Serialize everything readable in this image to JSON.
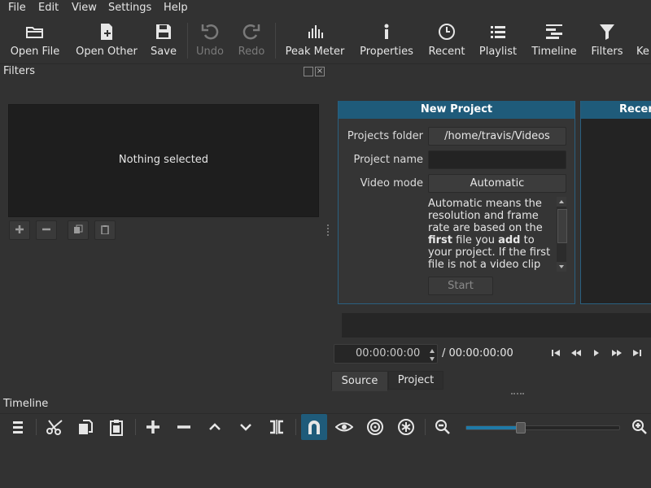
{
  "menu": [
    "File",
    "Edit",
    "View",
    "Settings",
    "Help"
  ],
  "toolbar": {
    "open_file": "Open File",
    "open_other": "Open Other",
    "save": "Save",
    "undo": "Undo",
    "redo": "Redo",
    "peak_meter": "Peak Meter",
    "properties": "Properties",
    "recent": "Recent",
    "playlist": "Playlist",
    "timeline": "Timeline",
    "filters": "Filters",
    "keyframes": "Ke"
  },
  "filters": {
    "title": "Filters",
    "empty_text": "Nothing selected"
  },
  "new_project": {
    "title": "New Project",
    "folder_label": "Projects folder",
    "folder_value": "/home/travis/Videos",
    "name_label": "Project name",
    "name_value": "",
    "mode_label": "Video mode",
    "mode_value": "Automatic",
    "desc_1": "Automatic means the resolution and frame rate are based on the ",
    "desc_2": "first",
    "desc_3": " file you ",
    "desc_4": "add",
    "desc_5": " to your project. If the first file is not a video clip",
    "start": "Start"
  },
  "recent": {
    "title": "Recen"
  },
  "player": {
    "position": "00:00:00:00",
    "duration": "/ 00:00:00:00"
  },
  "tabs": {
    "source": "Source",
    "project": "Project"
  },
  "timeline": {
    "title": "Timeline",
    "zoom_level": 0.35
  },
  "colors": {
    "accent": "#1f5b7a",
    "active_toggle": "#1f5b7a"
  }
}
